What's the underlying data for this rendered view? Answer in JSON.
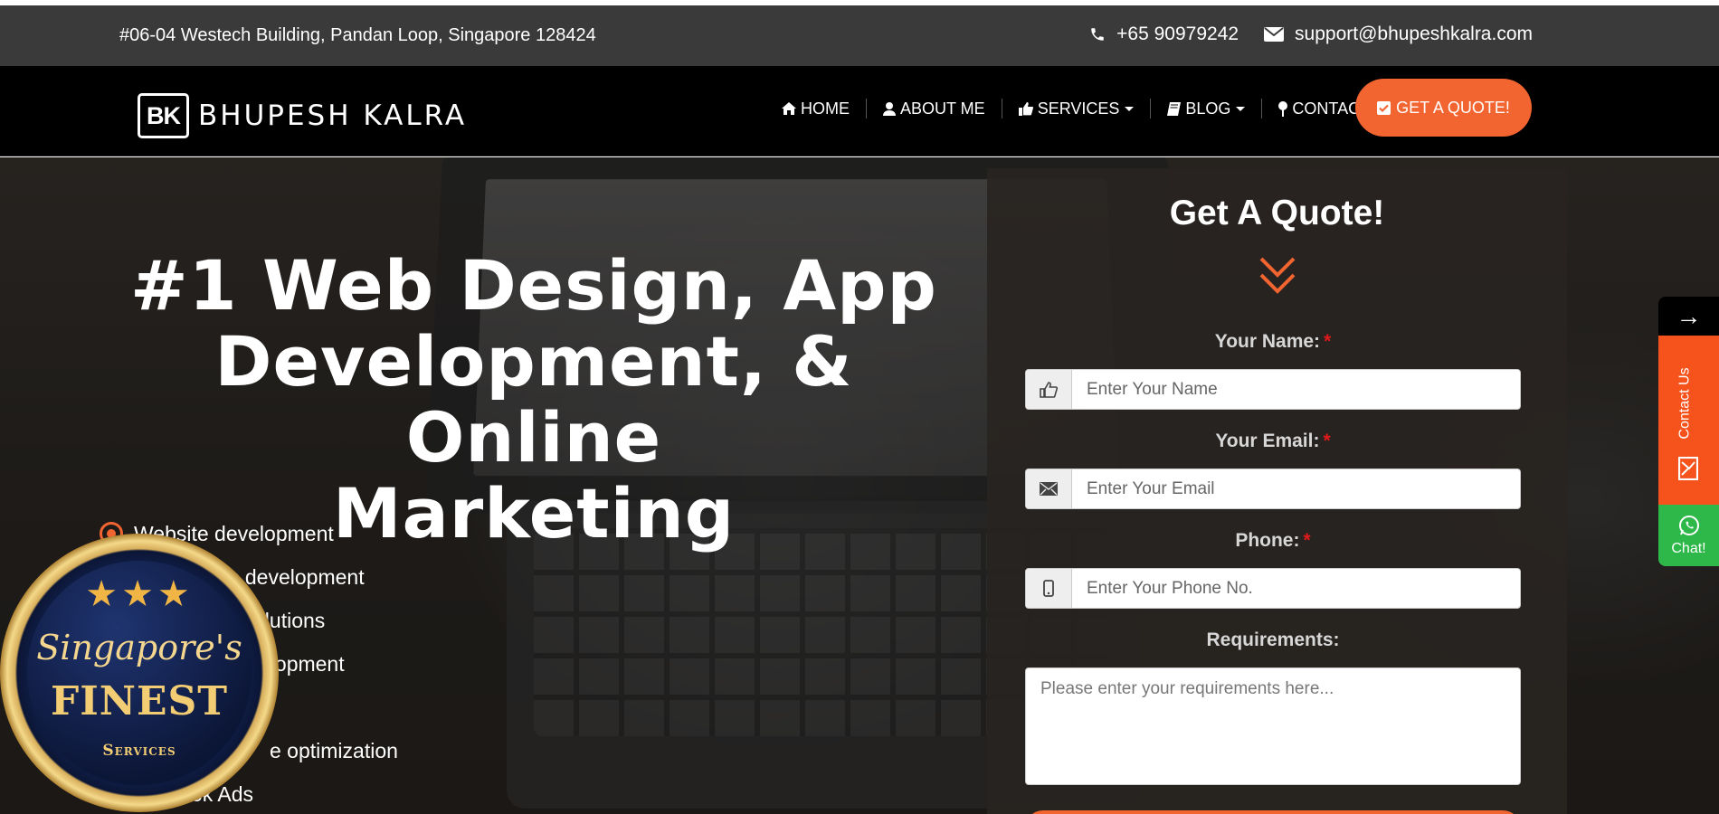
{
  "topbar": {
    "address": "#06-04 Westech Building, Pandan Loop, Singapore 128424",
    "phone": "+65 90979242",
    "email": "support@bhupeshkalra.com",
    "phone_icon": "phone-icon",
    "email_icon": "envelope-icon"
  },
  "logo": {
    "mark": "BK",
    "name": "BHUPESH KALRA"
  },
  "nav": {
    "items": [
      {
        "label": "HOME",
        "icon": "home-icon"
      },
      {
        "label": "ABOUT ME",
        "icon": "user-icon"
      },
      {
        "label": "SERVICES",
        "icon": "thumbs-up-icon",
        "dropdown": true
      },
      {
        "label": "BLOG",
        "icon": "book-icon",
        "dropdown": true
      },
      {
        "label": "CONTACT",
        "icon": "map-pin-icon"
      }
    ],
    "cta_label": "GET A QUOTE!",
    "cta_icon": "check-square-icon"
  },
  "hero": {
    "headline_line1": "#1 Web Design, App",
    "headline_line2": "Development, & Online",
    "headline_line3": "Marketing",
    "services": [
      "Website development",
      "s development",
      "olutions",
      "elopment",
      "",
      "e optimization",
      "ok Ads"
    ]
  },
  "badge": {
    "top": "Singapore's",
    "main": "FINEST",
    "bottom": "Services"
  },
  "quote_form": {
    "title": "Get A Quote!",
    "name_label": "Your Name:",
    "name_placeholder": "Enter Your Name",
    "email_label": "Your Email:",
    "email_placeholder": "Enter Your Email",
    "phone_label": "Phone:",
    "phone_placeholder": "Enter Your Phone No.",
    "required_mark": "*",
    "requirements_label": "Requirements:",
    "requirements_placeholder": "Please enter your requirements here..."
  },
  "side_tab": {
    "arrow": "→",
    "contact_label": "Contact Us",
    "chat_label": "Chat!"
  },
  "colors": {
    "accent": "#f26430",
    "topbar_bg": "#3a3a3a",
    "nav_bg": "#000000",
    "chat_green": "#2fb84a",
    "required_red": "#e01a1a"
  }
}
